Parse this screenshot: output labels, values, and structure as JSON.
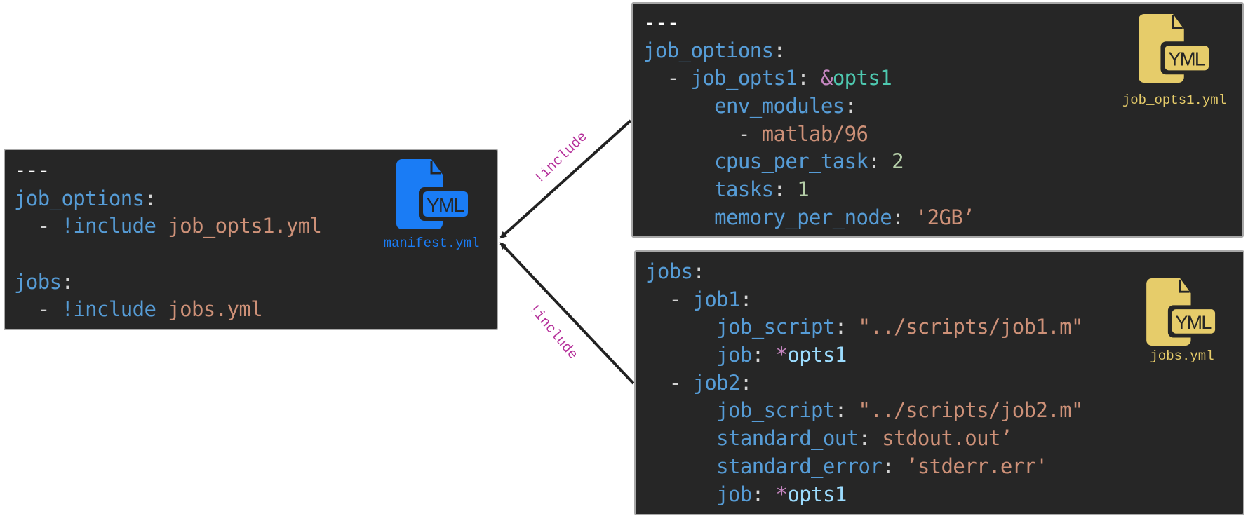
{
  "colors": {
    "manifest_icon": "#1a7cf5",
    "included_icon": "#e6cc6a",
    "edge_label": "#b5309a",
    "panel_bg": "#262626"
  },
  "edges": [
    {
      "label": "!include",
      "from": "job_opts1.yml",
      "to": "manifest.yml"
    },
    {
      "label": "!include",
      "from": "jobs.yml",
      "to": "manifest.yml"
    }
  ],
  "files": {
    "manifest": {
      "name": "manifest.yml",
      "icon": "yml-file-icon",
      "lines": [
        [
          [
            "doc",
            "---"
          ]
        ],
        [
          [
            "key",
            "job_options"
          ],
          [
            "punct",
            ":"
          ]
        ],
        [
          [
            "punct",
            "  - "
          ],
          [
            "tag",
            "!include"
          ],
          [
            "punct",
            " "
          ],
          [
            "str",
            "job_opts1.yml"
          ]
        ],
        [],
        [
          [
            "key",
            "jobs"
          ],
          [
            "punct",
            ":"
          ]
        ],
        [
          [
            "punct",
            "  - "
          ],
          [
            "tag",
            "!include"
          ],
          [
            "punct",
            " "
          ],
          [
            "str",
            "jobs.yml"
          ]
        ]
      ]
    },
    "job_opts1": {
      "name": "job_opts1.yml",
      "icon": "yml-file-icon",
      "lines": [
        [
          [
            "doc",
            "---"
          ]
        ],
        [
          [
            "key",
            "job_options"
          ],
          [
            "punct",
            ":"
          ]
        ],
        [
          [
            "punct",
            "  - "
          ],
          [
            "key",
            "job_opts1"
          ],
          [
            "punct",
            ": "
          ],
          [
            "anchor",
            "&"
          ],
          [
            "anchorname",
            "opts1"
          ]
        ],
        [
          [
            "punct",
            "      "
          ],
          [
            "key",
            "env_modules"
          ],
          [
            "punct",
            ":"
          ]
        ],
        [
          [
            "punct",
            "        - "
          ],
          [
            "str",
            "matlab/96"
          ]
        ],
        [
          [
            "punct",
            "      "
          ],
          [
            "key",
            "cpus_per_task"
          ],
          [
            "punct",
            ": "
          ],
          [
            "num",
            "2"
          ]
        ],
        [
          [
            "punct",
            "      "
          ],
          [
            "key",
            "tasks"
          ],
          [
            "punct",
            ": "
          ],
          [
            "num",
            "1"
          ]
        ],
        [
          [
            "punct",
            "      "
          ],
          [
            "key",
            "memory_per_node"
          ],
          [
            "punct",
            ": "
          ],
          [
            "str",
            "'2GB’"
          ]
        ]
      ]
    },
    "jobs": {
      "name": "jobs.yml",
      "icon": "yml-file-icon",
      "lines": [
        [
          [
            "key",
            "jobs"
          ],
          [
            "punct",
            ":"
          ]
        ],
        [
          [
            "punct",
            "  - "
          ],
          [
            "key",
            "job1"
          ],
          [
            "punct",
            ":"
          ]
        ],
        [
          [
            "punct",
            "      "
          ],
          [
            "key",
            "job_script"
          ],
          [
            "punct",
            ": "
          ],
          [
            "str",
            "\"../scripts/job1.m\""
          ]
        ],
        [
          [
            "punct",
            "      "
          ],
          [
            "key",
            "job"
          ],
          [
            "punct",
            ": "
          ],
          [
            "anchor",
            "*"
          ],
          [
            "alias",
            "opts1"
          ]
        ],
        [
          [
            "punct",
            "  - "
          ],
          [
            "key",
            "job2"
          ],
          [
            "punct",
            ":"
          ]
        ],
        [
          [
            "punct",
            "      "
          ],
          [
            "key",
            "job_script"
          ],
          [
            "punct",
            ": "
          ],
          [
            "str",
            "\"../scripts/job2.m\""
          ]
        ],
        [
          [
            "punct",
            "      "
          ],
          [
            "key",
            "standard_out"
          ],
          [
            "punct",
            ": "
          ],
          [
            "str",
            "stdout.out’"
          ]
        ],
        [
          [
            "punct",
            "      "
          ],
          [
            "key",
            "standard_error"
          ],
          [
            "punct",
            ": "
          ],
          [
            "str",
            "’stderr.err'"
          ]
        ],
        [
          [
            "punct",
            "      "
          ],
          [
            "key",
            "job"
          ],
          [
            "punct",
            ": "
          ],
          [
            "anchor",
            "*"
          ],
          [
            "alias",
            "opts1"
          ]
        ]
      ]
    }
  }
}
